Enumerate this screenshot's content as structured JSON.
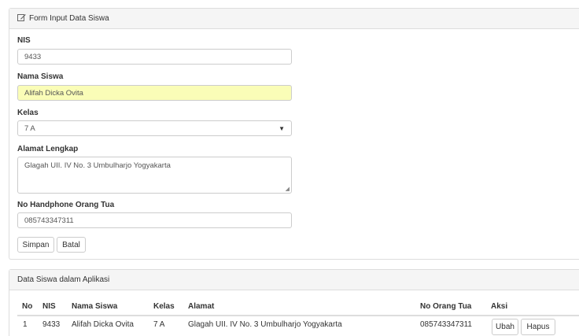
{
  "form": {
    "title": "Form Input Data Siswa",
    "title_icon": "edit-icon",
    "fields": {
      "nis": {
        "label": "NIS",
        "value": "9433"
      },
      "nama": {
        "label": "Nama Siswa",
        "value": "Alifah Dicka Ovita"
      },
      "kelas": {
        "label": "Kelas",
        "value": "7 A"
      },
      "alamat": {
        "label": "Alamat Lengkap",
        "value": "Glagah UII. IV No. 3 Umbulharjo Yogyakarta"
      },
      "hp": {
        "label": "No Handphone Orang Tua",
        "value": "085743347311"
      }
    },
    "buttons": {
      "save": "Simpan",
      "cancel": "Batal"
    },
    "highlight_color": "#fafdb7"
  },
  "list": {
    "title": "Data Siswa dalam Aplikasi",
    "columns": [
      "No",
      "NIS",
      "Nama Siswa",
      "Kelas",
      "Alamat",
      "No Orang Tua",
      "Aksi"
    ],
    "rows": [
      {
        "no": "1",
        "nis": "9433",
        "nama": "Alifah Dicka Ovita",
        "kelas": "7 A",
        "alamat": "Glagah UII. IV No. 3 Umbulharjo Yogyakarta",
        "hp": "085743347311",
        "edit_label": "Ubah",
        "delete_label": "Hapus"
      }
    ]
  }
}
